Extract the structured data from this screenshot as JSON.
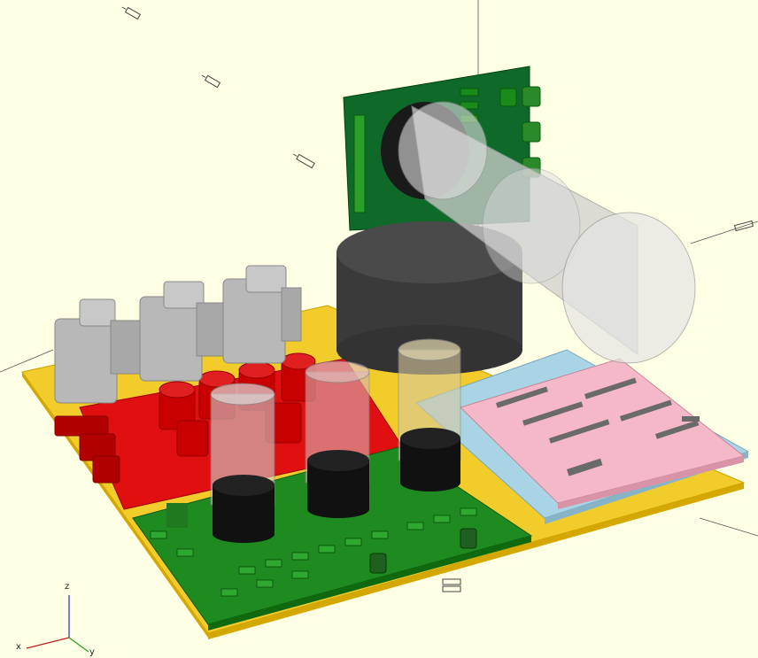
{
  "app": {
    "window_title": "",
    "view": "3D preview"
  },
  "axes": {
    "x_label": "x",
    "y_label": "y",
    "z_label": "z"
  },
  "colors": {
    "background": "#ffffe5",
    "base_plate": "#f2cc2a",
    "green_pcb": "#1f8a1f",
    "red_pcb": "#e01010",
    "pink_pcb": "#f5b8c8",
    "blue_pcb": "#a8d4e6",
    "dark_parts": "#3a3a3a",
    "transformers": "#b8b8b8",
    "glass_tubes": "#c8c8c8"
  },
  "scene_objects": [
    {
      "name": "yellow-base-plate"
    },
    {
      "name": "green-amplifier-board"
    },
    {
      "name": "red-power-board"
    },
    {
      "name": "pink-control-board"
    },
    {
      "name": "blue-substrate-board"
    },
    {
      "name": "vertical-green-pcb"
    },
    {
      "name": "cylindrical-enclosure"
    },
    {
      "name": "glass-cone-tube"
    },
    {
      "name": "vacuum-tubes"
    },
    {
      "name": "transformers"
    }
  ]
}
